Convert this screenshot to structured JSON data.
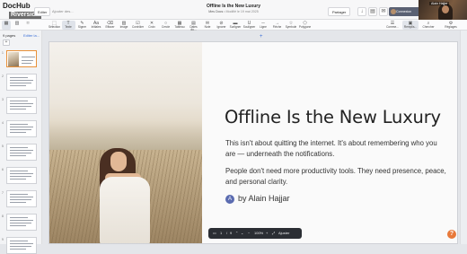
{
  "app": {
    "logo": "DocHub",
    "logo_sub": "Riverside"
  },
  "topbar": {
    "tab_label": "Editer",
    "add_description": "Ajouter des...",
    "doc_title": "Offline Is the New Luxury",
    "doc_meta_left": "Mes Docs",
    "doc_meta_right": "Modifié le 19 mai 2025",
    "share_label": "Partager",
    "user_label": "Connexion",
    "video_name": "Alain Hajjar"
  },
  "toolbar": {
    "left": [
      "Sélection",
      "Texte",
      "Signer",
      "Initiales",
      "Effacer",
      "Image",
      "Contrôler",
      "Croix",
      "Cercle",
      "Tableau",
      "Dates du...",
      "Note",
      "Ignorer",
      "Surligner",
      "Souligner",
      "Ligne",
      "Flèche",
      "Symbole",
      "Polygone"
    ],
    "right": [
      "Comme...",
      "Remplis...",
      "Chercher",
      "Réglages"
    ]
  },
  "sidebar": {
    "header": "9 pages",
    "edit": "Editer la...",
    "thumbnails": [
      "1",
      "2",
      "3",
      "4",
      "5",
      "6",
      "7",
      "8",
      "9"
    ]
  },
  "slide": {
    "headline": "Offline Is the New Luxury",
    "para1": "This isn't about quitting the internet. It's about remembering who you are — underneath the notifications.",
    "para2": "People don't need more productivity tools. They need presence, peace, and personal clarity.",
    "byline_initial": "A",
    "byline": "by Alain Hajjar"
  },
  "controls": {
    "page_current": "1",
    "page_sep": "/",
    "page_total": "9",
    "zoom": "100%",
    "adjust": "Ajuster"
  },
  "colors": {
    "accent_orange": "#e8793a",
    "selected_border": "#e8913a",
    "link_blue": "#3b6fd6",
    "control_bar": "#2b2e34"
  }
}
